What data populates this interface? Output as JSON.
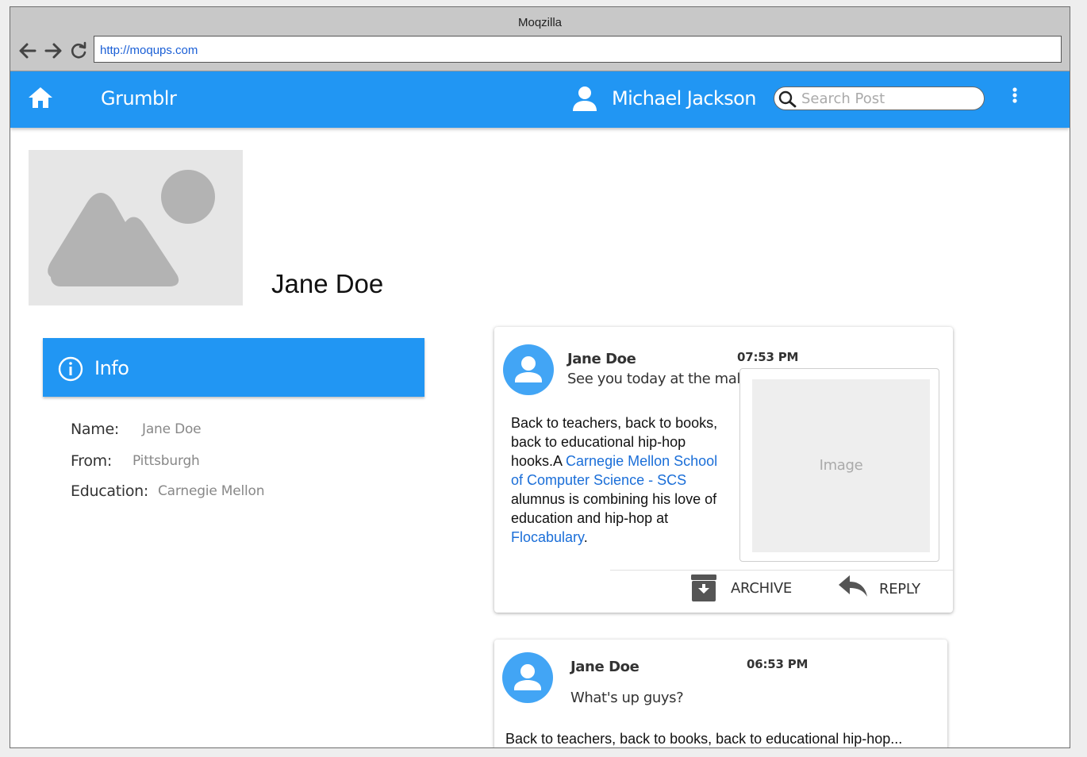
{
  "window": {
    "title": "Moqzilla"
  },
  "browser": {
    "url": "http://moqups.com"
  },
  "appbar": {
    "brand": "Grumblr",
    "user_name": "Michael Jackson",
    "search_placeholder": "Search Post",
    "accent_color": "#2196f3"
  },
  "profile": {
    "name": "Jane Doe",
    "info": {
      "title": "Info",
      "rows": [
        {
          "label": "Name:",
          "value": "Jane Doe"
        },
        {
          "label": "From:",
          "value": "Pittsburgh"
        },
        {
          "label": "Education:",
          "value": "Carnegie Mellon"
        }
      ]
    }
  },
  "posts": [
    {
      "author": "Jane Doe",
      "time": "07:53 PM",
      "subtitle": "See you today at the mall",
      "body": {
        "t1": "Back to teachers, back to books, back to educational hip-hop hooks.A ",
        "link1": "Carnegie Mellon School of Computer Science - SCS",
        "t2": " alumnus is combining his love of education and hip-hop at ",
        "link2": "Flocabulary",
        "t3": "."
      },
      "image_label": "Image",
      "actions": {
        "archive": "ARCHIVE",
        "reply": "REPLY"
      }
    },
    {
      "author": "Jane Doe",
      "time": "06:53 PM",
      "subtitle": "What's up guys?",
      "preview": "Back to teachers, back to books, back to educational hip-hop..."
    }
  ]
}
